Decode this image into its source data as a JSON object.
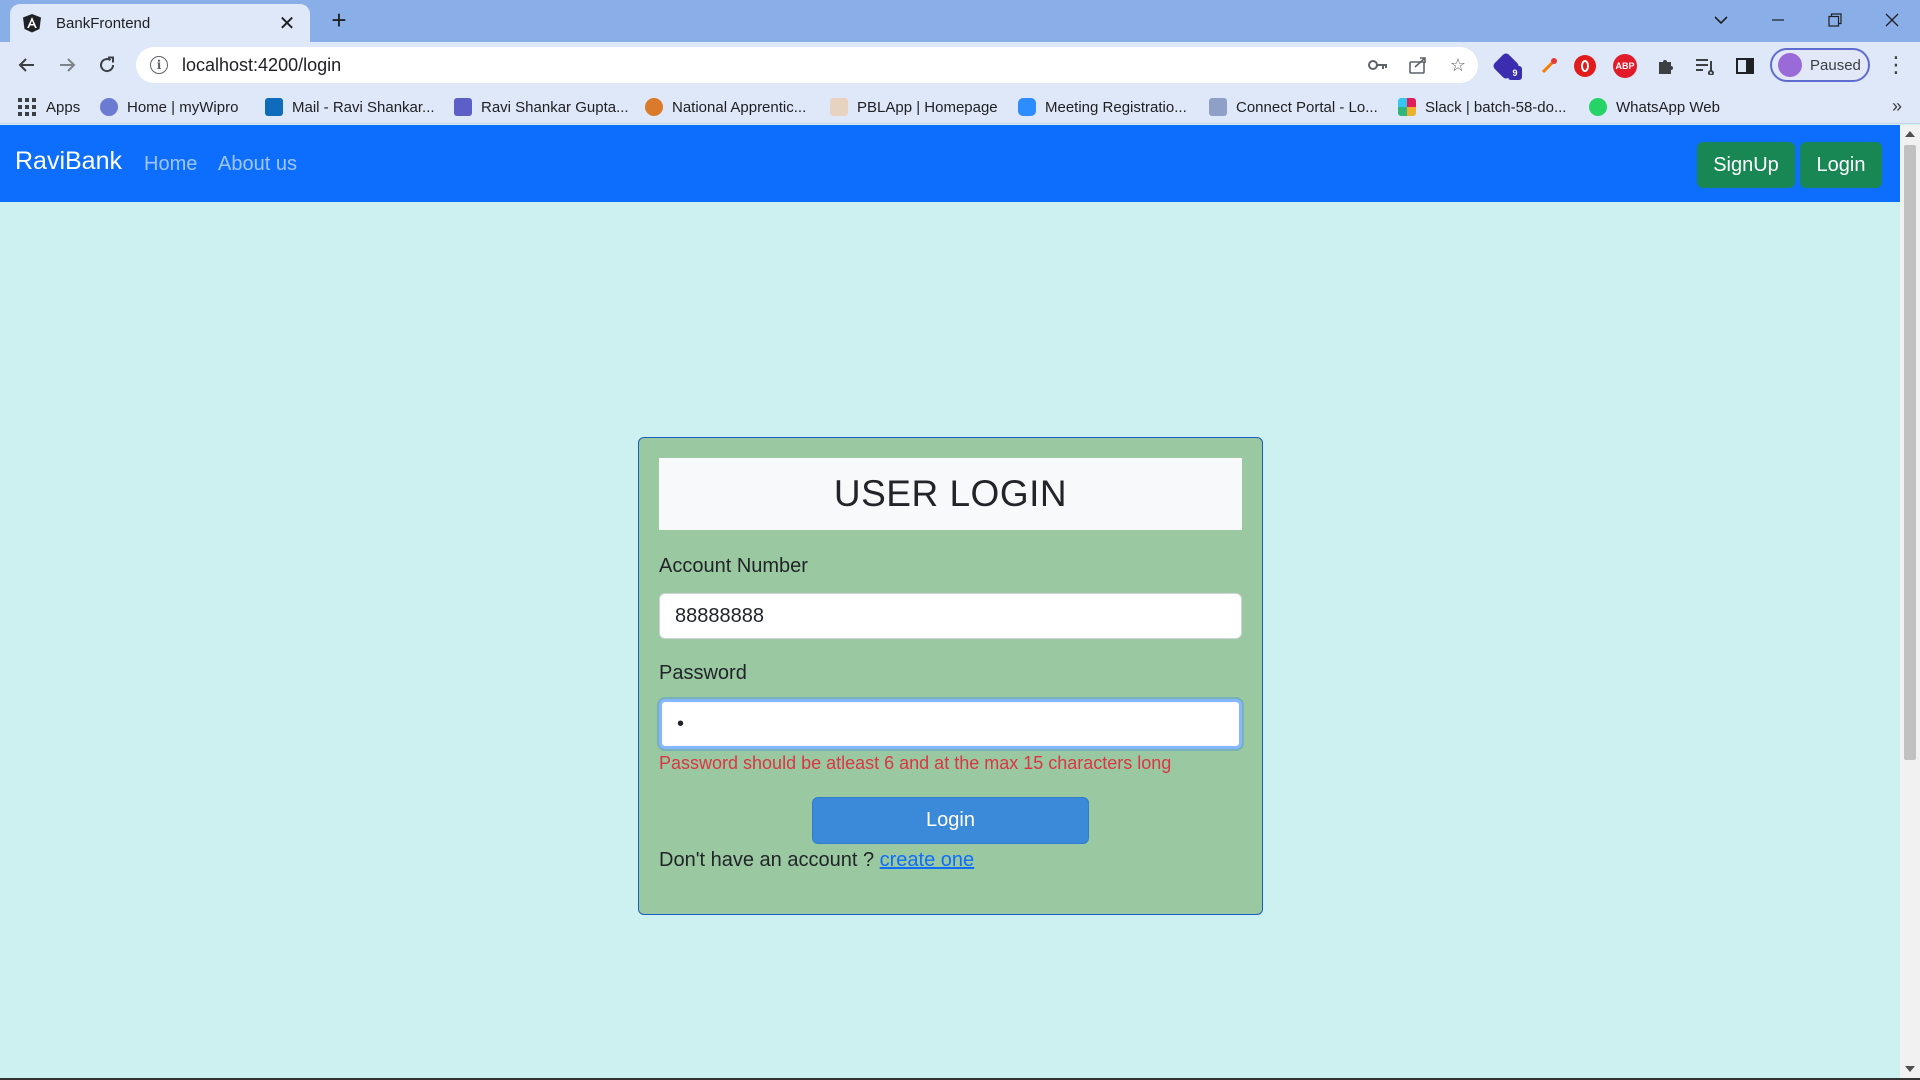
{
  "browser": {
    "tab_title": "BankFrontend",
    "tab_close": "✕",
    "new_tab": "+",
    "url": "localhost:4200/login",
    "profile_label": "Paused",
    "bookmarks": [
      {
        "label": "Apps",
        "color": "#5f6368"
      },
      {
        "label": "Home | myWipro",
        "color": "#6a7bd1"
      },
      {
        "label": "Mail - Ravi Shankar...",
        "color": "#0f6cbd"
      },
      {
        "label": "Ravi Shankar Gupta...",
        "color": "#5b5fc7"
      },
      {
        "label": "National Apprentic...",
        "color": "#d97b2b"
      },
      {
        "label": "PBLApp | Homepage",
        "color": "#e8d3c0"
      },
      {
        "label": "Meeting Registratio...",
        "color": "#2d8cff"
      },
      {
        "label": "Connect Portal - Lo...",
        "color": "#8fa0c8"
      },
      {
        "label": "Slack | batch-58-do...",
        "color": "#e01e5a"
      },
      {
        "label": "WhatsApp Web",
        "color": "#25d366"
      }
    ],
    "extension_badge": "9",
    "extension_abp": "ABP"
  },
  "navbar": {
    "brand": "RaviBank",
    "links": [
      "Home",
      "About us"
    ],
    "signup_label": "SignUp",
    "login_label": "Login",
    "bg_color": "#0d6efd",
    "button_color": "#198754"
  },
  "login_form": {
    "title": "USER LOGIN",
    "account_label": "Account Number",
    "account_value": "88888888",
    "password_label": "Password",
    "password_value": "•",
    "error": "Password should be atleast 6 and at the max 15 characters long",
    "submit_label": "Login",
    "signup_prompt": "Don't have an account ? ",
    "signup_link": "create one",
    "card_color": "#9ac8a0",
    "page_bg": "#cdf0f0"
  }
}
